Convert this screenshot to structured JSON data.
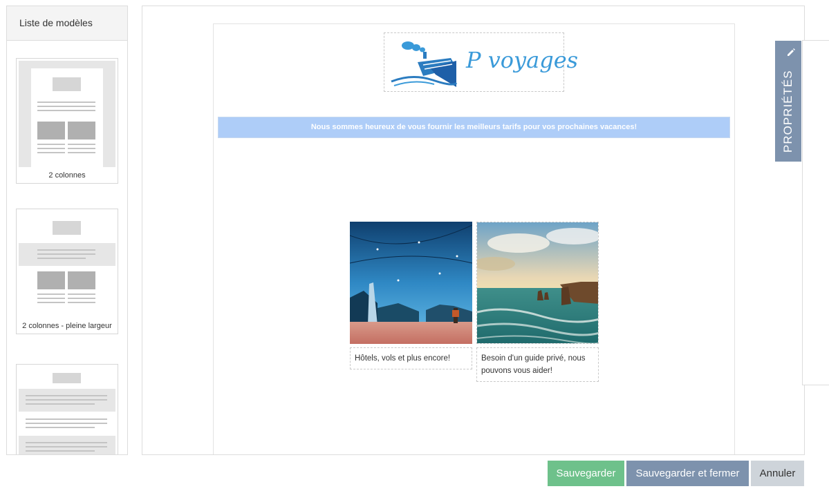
{
  "sidebar": {
    "title": "Liste de modèles",
    "templates": [
      {
        "label": "2 colonnes"
      },
      {
        "label": "2 colonnes - pleine largeur"
      },
      {
        "label": ""
      }
    ]
  },
  "email": {
    "logo_text": "P voyages",
    "banner_text": "Nous sommes heureux de vous fournir les meilleurs tarifs pour vos prochaines vacances!",
    "columns": [
      {
        "image": "city-night-photo",
        "caption": "Hôtels, vols et plus encore!"
      },
      {
        "image": "coast-sunset-photo",
        "caption": "Besoin d'un guide privé, nous pouvons vous aider!"
      }
    ]
  },
  "properties": {
    "tab_label": "PROPRIÉTÉS",
    "icon": "pencil-icon"
  },
  "actions": {
    "save": "Sauvegarder",
    "save_close": "Sauvegarder et fermer",
    "cancel": "Annuler"
  },
  "colors": {
    "brand_blue": "#3a9ad9",
    "banner_bg": "#aecdf8",
    "save_green": "#6ec18b",
    "slate_blue": "#7d92ad",
    "cancel_gray": "#ced4da"
  }
}
